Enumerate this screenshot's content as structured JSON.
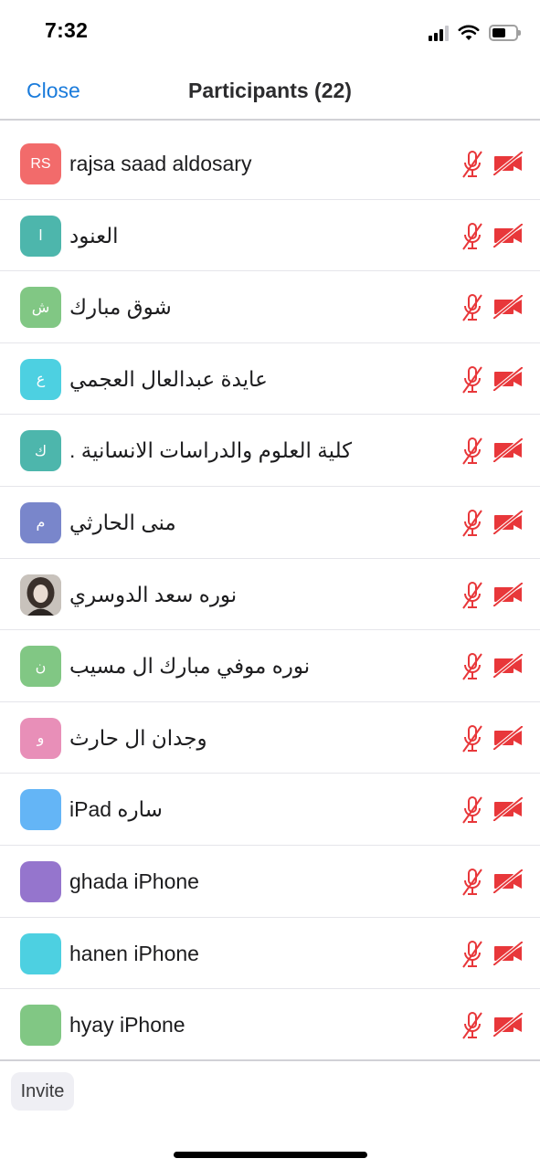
{
  "status_bar": {
    "time": "7:32"
  },
  "nav": {
    "close_label": "Close",
    "title": "Participants (22)"
  },
  "colors": {
    "accent": "#1a7bdb",
    "muted_red": "#e8373a"
  },
  "participants": [
    {
      "name": "rajsa saad aldosary",
      "initials": "RS",
      "avatar_color": "#f26b6b",
      "dir": "ltr",
      "mic_muted": true,
      "video_off": true
    },
    {
      "name": "العنود",
      "initials": "ا",
      "avatar_color": "#4db6ac",
      "dir": "rtl",
      "mic_muted": true,
      "video_off": true
    },
    {
      "name": "شوق مبارك",
      "initials": "ش",
      "avatar_color": "#81c784",
      "dir": "rtl",
      "mic_muted": true,
      "video_off": true
    },
    {
      "name": "عايدة عبدالعال العجمي",
      "initials": "ع",
      "avatar_color": "#4dd0e1",
      "dir": "rtl",
      "mic_muted": true,
      "video_off": true
    },
    {
      "name": "كلية العلوم والدراسات الانسانية .",
      "initials": "ك",
      "avatar_color": "#4db6ac",
      "dir": "rtl",
      "mic_muted": true,
      "video_off": true
    },
    {
      "name": "منى الحارثي",
      "initials": "م",
      "avatar_color": "#7986cb",
      "dir": "rtl",
      "mic_muted": true,
      "video_off": true
    },
    {
      "name": "نوره سعد الدوسري",
      "initials": "",
      "avatar_color": "#b8b0a8",
      "dir": "rtl",
      "photo": true,
      "mic_muted": true,
      "video_off": true
    },
    {
      "name": "نوره موفي مبارك ال مسيب",
      "initials": "ن",
      "avatar_color": "#81c784",
      "dir": "rtl",
      "mic_muted": true,
      "video_off": true
    },
    {
      "name": "وجدان ال حارث",
      "initials": "و",
      "avatar_color": "#e88fb8",
      "dir": "rtl",
      "mic_muted": true,
      "video_off": true
    },
    {
      "name": "ساره iPad",
      "initials": "",
      "avatar_color": "#64b5f6",
      "dir": "rtl",
      "mic_muted": true,
      "video_off": true
    },
    {
      "name": "ghada iPhone",
      "initials": "",
      "avatar_color": "#9575cd",
      "dir": "ltr",
      "mic_muted": true,
      "video_off": true
    },
    {
      "name": "hanen iPhone",
      "initials": "",
      "avatar_color": "#4dd0e1",
      "dir": "ltr",
      "mic_muted": true,
      "video_off": true
    },
    {
      "name": "hyay iPhone",
      "initials": "",
      "avatar_color": "#81c784",
      "dir": "ltr",
      "mic_muted": true,
      "video_off": true
    }
  ],
  "footer": {
    "invite_label": "Invite"
  }
}
